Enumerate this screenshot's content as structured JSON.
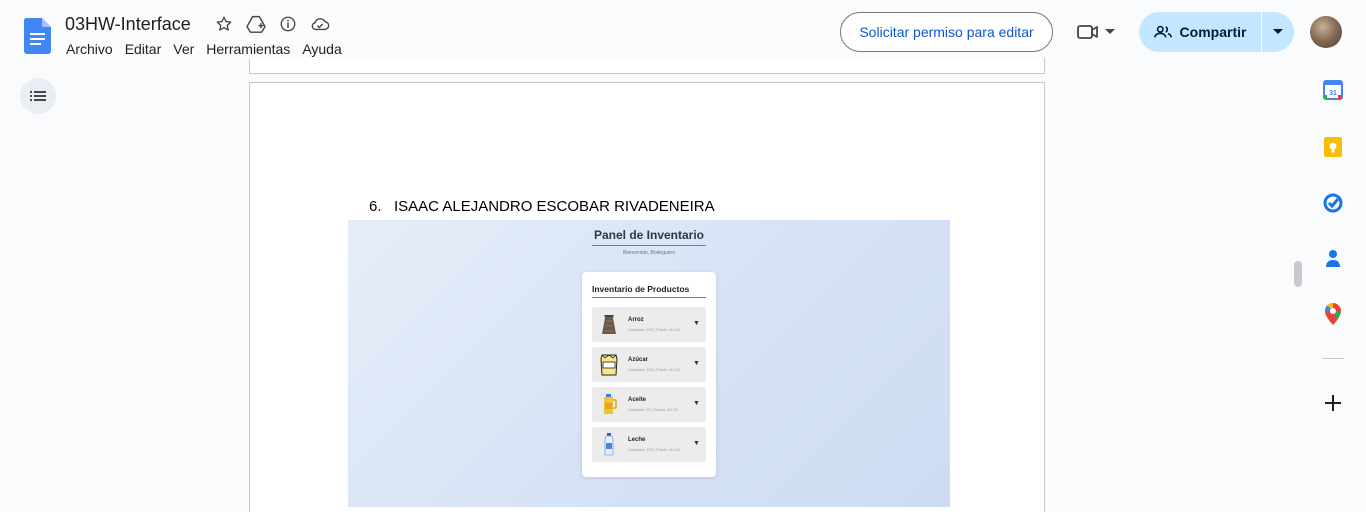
{
  "app": {
    "doc_title": "03HW-Interface",
    "title_icons": [
      "star-icon",
      "move-to-drive-icon",
      "info-icon",
      "cloud-saved-icon"
    ]
  },
  "menu": [
    "Archivo",
    "Editar",
    "Ver",
    "Herramientas",
    "Ayuda"
  ],
  "header_actions": {
    "request_edit_label": "Solicitar permiso para editar",
    "share_label": "Compartir"
  },
  "document": {
    "list_item_number": "6.",
    "list_item_text": "ISAAC ALEJANDRO ESCOBAR RIVADENEIRA"
  },
  "embedded_image": {
    "panel_title": "Panel de Inventario",
    "panel_subtitle": "Bienvenido, Bodeguero",
    "card_title": "Inventario de Productos",
    "products": [
      {
        "name": "Arroz",
        "details": "Cantidad: 200 | Precio: $1.50",
        "icon": "rice-sack-icon"
      },
      {
        "name": "Azúcar",
        "details": "Cantidad: 150 | Precio: $1.20",
        "icon": "sugar-bag-icon"
      },
      {
        "name": "Aceite",
        "details": "Cantidad: 50 | Precio: $3.00",
        "icon": "oil-bottle-icon"
      },
      {
        "name": "Leche",
        "details": "Cantidad: 100 | Precio: $1.00",
        "icon": "milk-bottle-icon"
      }
    ]
  },
  "side_panel": {
    "calendar_day": "31",
    "icons": [
      "calendar-icon",
      "keep-icon",
      "tasks-icon",
      "contacts-icon",
      "maps-icon",
      "add-icon"
    ]
  },
  "colors": {
    "accent_blue": "#0b57d0",
    "share_bg": "#c2e7ff",
    "inventory_green": "#3fa34d"
  }
}
